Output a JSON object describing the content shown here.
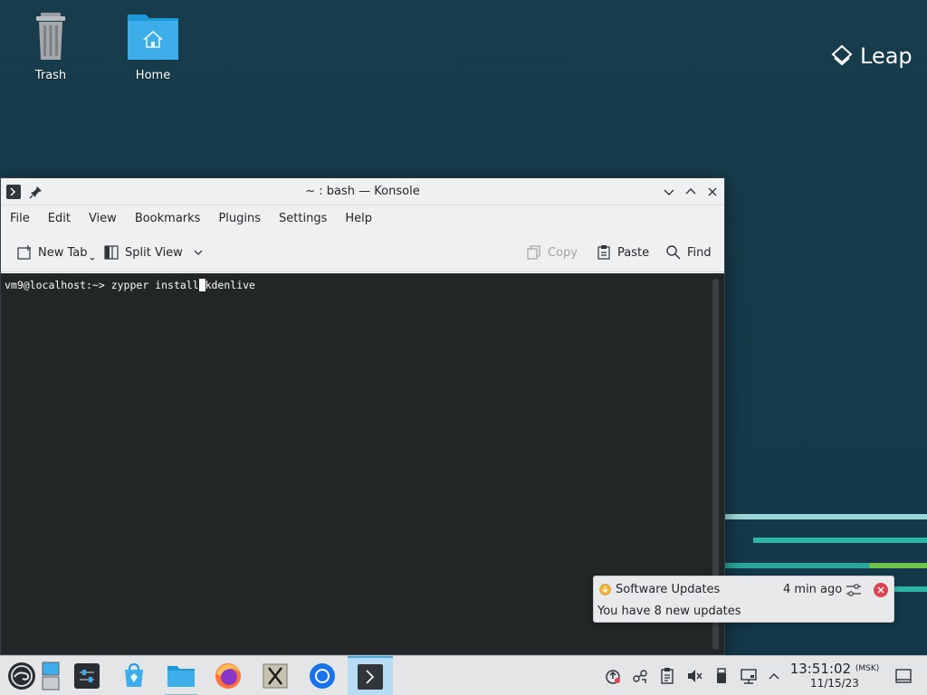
{
  "desktop": {
    "icons": [
      {
        "label": "Trash"
      },
      {
        "label": "Home"
      }
    ],
    "brand": "Leap"
  },
  "window": {
    "title": "~ : bash — Konsole",
    "menu": [
      "File",
      "Edit",
      "View",
      "Bookmarks",
      "Plugins",
      "Settings",
      "Help"
    ],
    "toolbar": {
      "new_tab": "New Tab",
      "split_view": "Split View",
      "copy": "Copy",
      "paste": "Paste",
      "find": "Find"
    },
    "terminal": {
      "prompt": "vm9@localhost:~> ",
      "command_before_cursor": "zypper install",
      "cursor_char": " ",
      "command_after_cursor": "kdenlive"
    }
  },
  "notification": {
    "app": "Software Updates",
    "time": "4 min ago",
    "body": "You have 8 new updates"
  },
  "taskbar": {
    "apps": [
      "application-launcher-icon",
      "desktop-pager-icon",
      "system-settings-icon",
      "discover-icon",
      "dolphin-icon",
      "firefox-icon",
      "xterm-icon",
      "chromium-icon",
      "konsole-icon"
    ],
    "clock": {
      "time": "13:51:02",
      "timezone": "(MSK)",
      "date": "11/15/23"
    }
  },
  "colors": {
    "accent": "#3daee9",
    "desktop_bg": "#173d4d",
    "terminal_bg": "#232627",
    "terminal_fg": "#fcfcfc"
  }
}
